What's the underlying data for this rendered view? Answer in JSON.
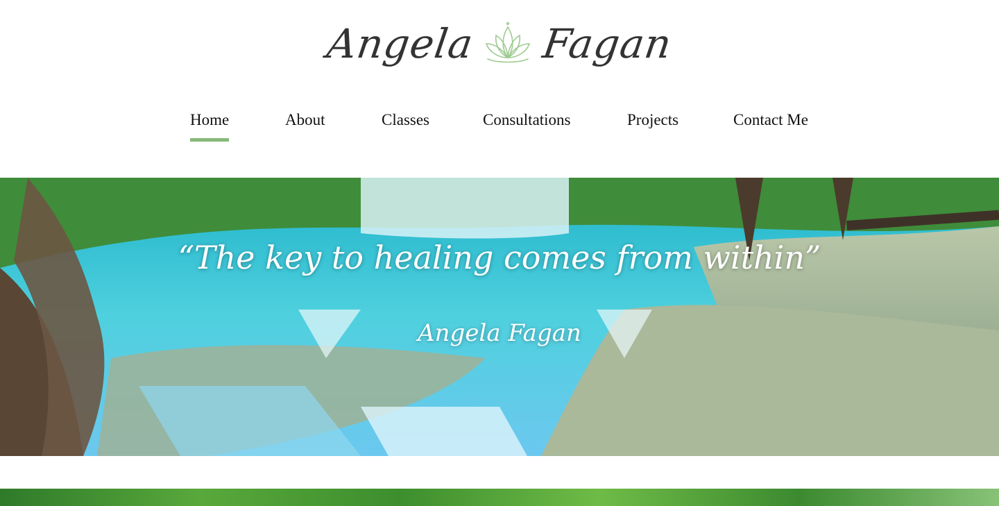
{
  "logo": {
    "first_name": "Angela",
    "last_name": "Fagan",
    "icon": "lotus-icon",
    "icon_color": "#9cc98f"
  },
  "nav": {
    "items": [
      {
        "label": "Home",
        "active": true
      },
      {
        "label": "About",
        "active": false
      },
      {
        "label": "Classes",
        "active": false
      },
      {
        "label": "Consultations",
        "active": false
      },
      {
        "label": "Projects",
        "active": false
      },
      {
        "label": "Contact Me",
        "active": false
      }
    ],
    "accent_color": "#86b97a"
  },
  "hero": {
    "quote": "“The key to healing comes from within”",
    "author": "Angela Fagan"
  }
}
